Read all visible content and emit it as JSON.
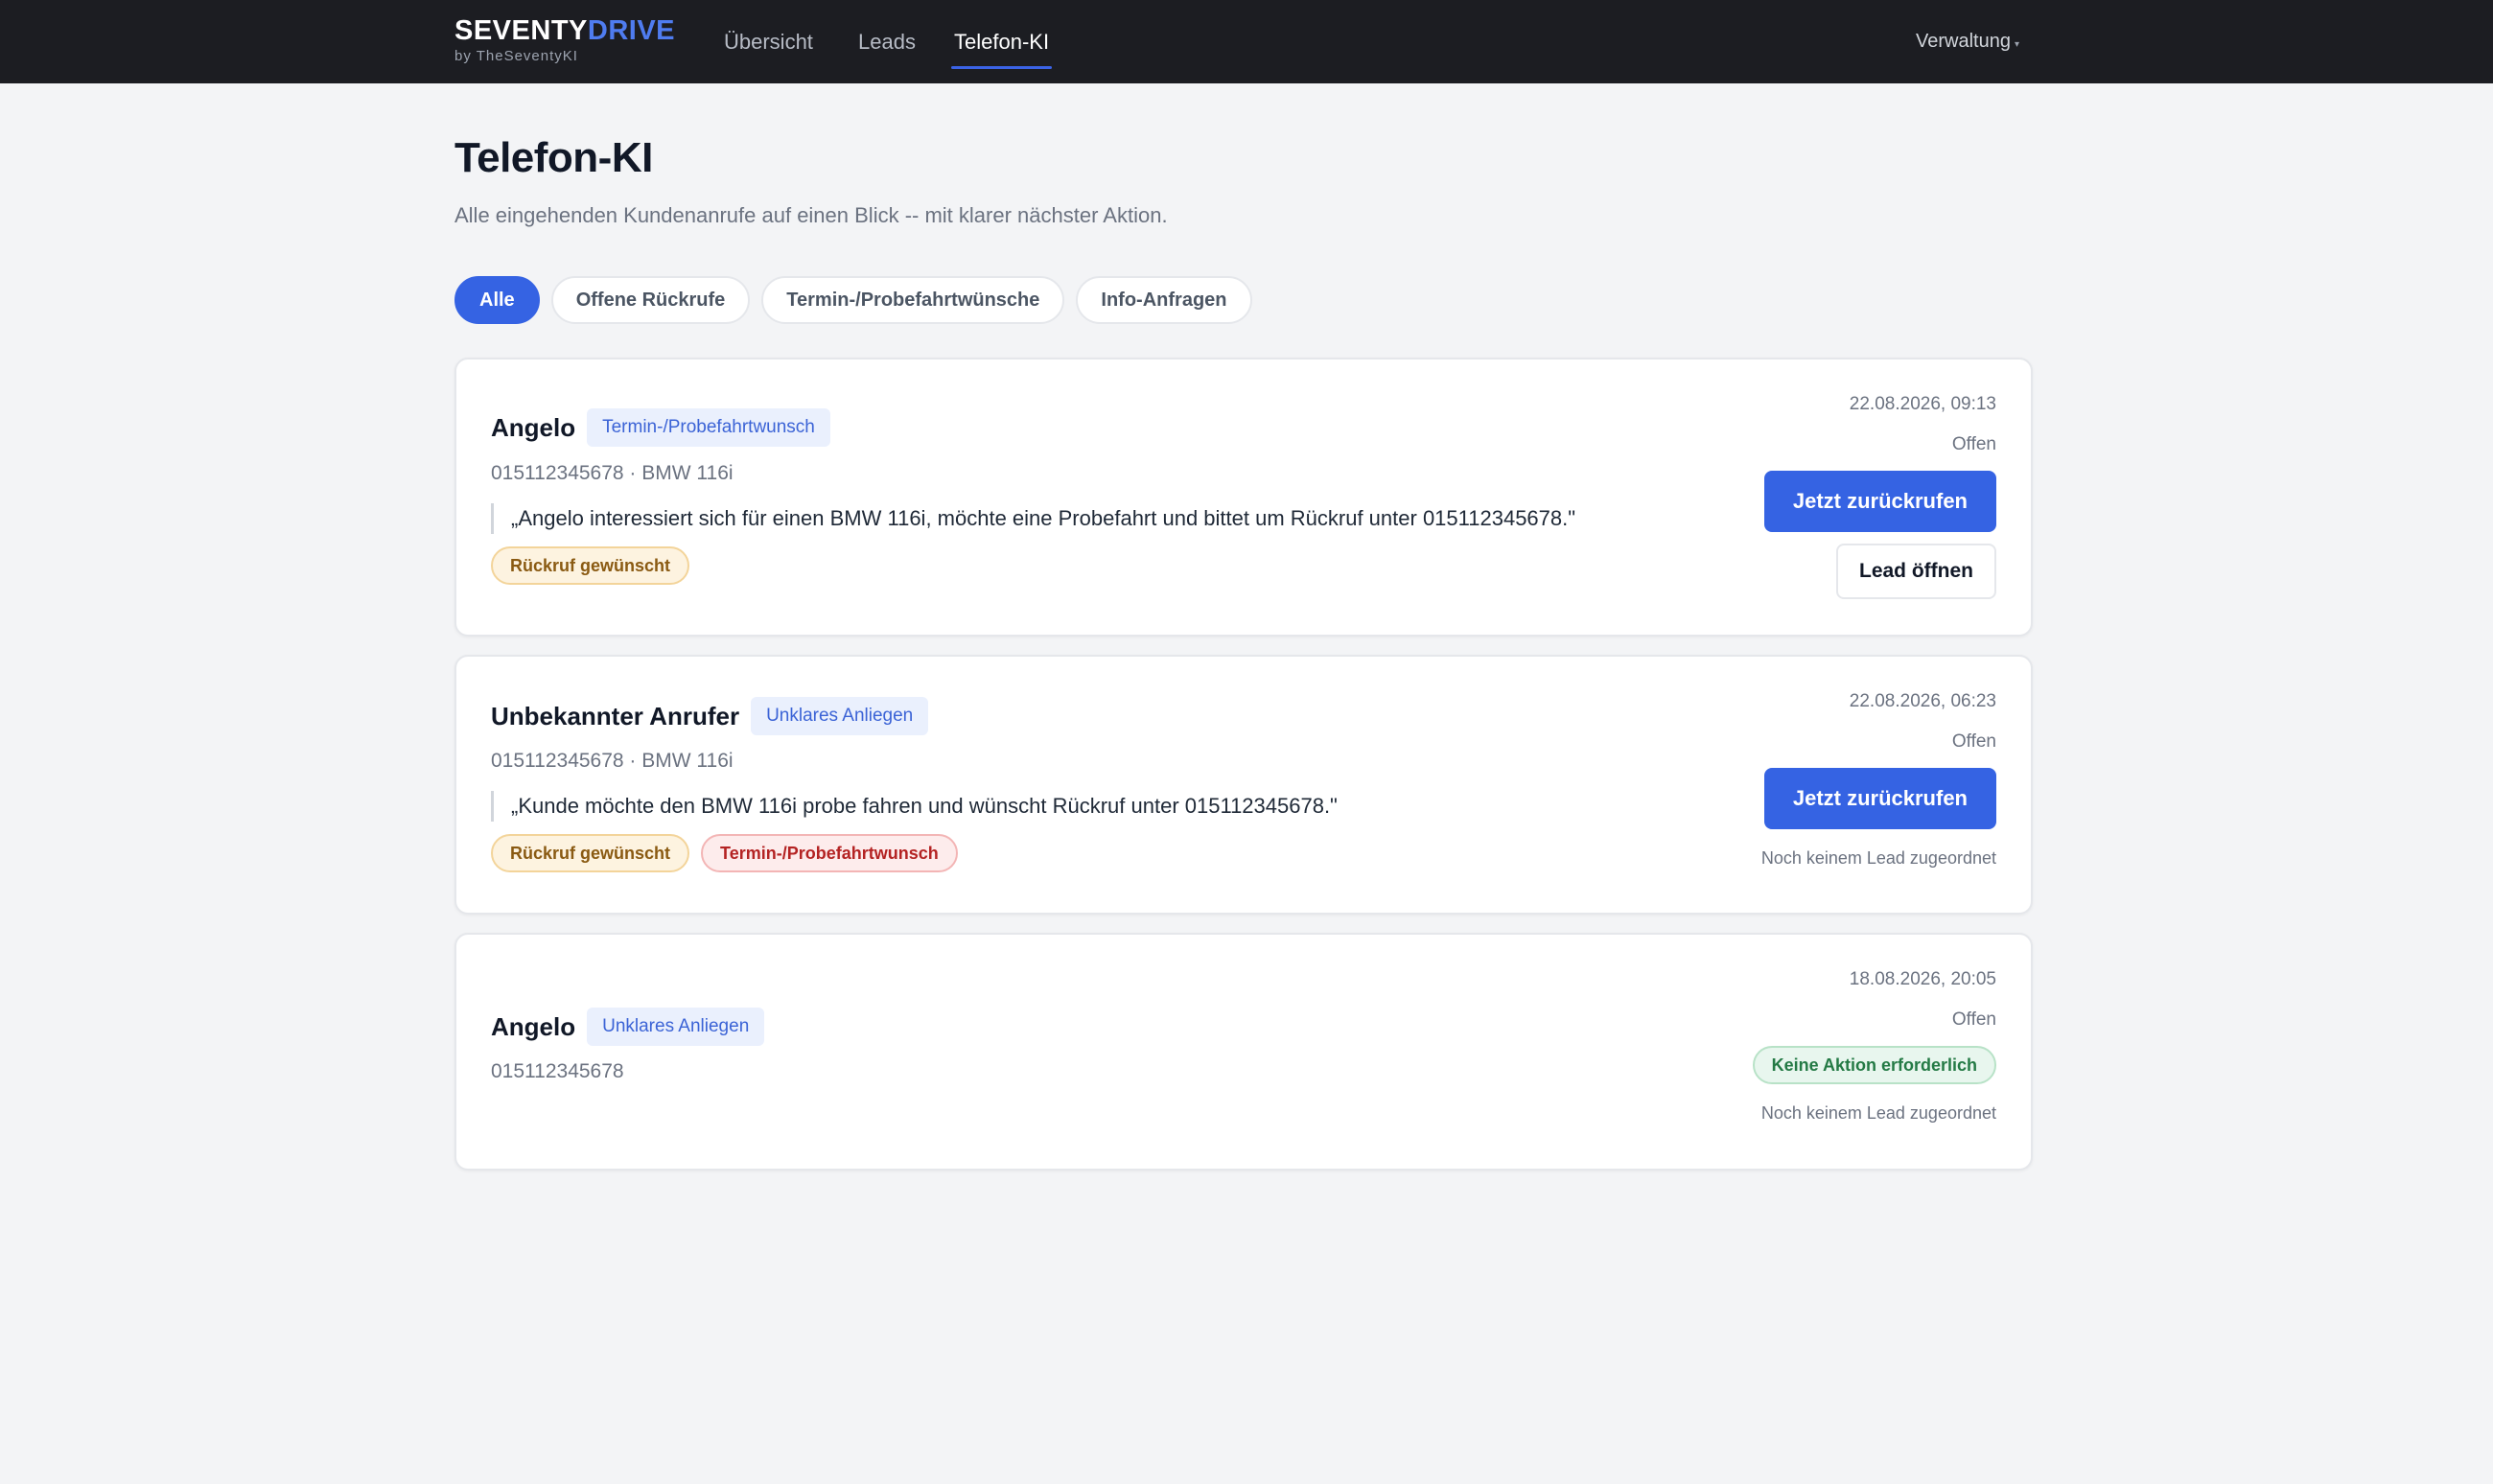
{
  "nav": {
    "brand_word1": "SEVENTY",
    "brand_word2": "DRIVE",
    "brand_sub": "by TheSeventyKI",
    "items": [
      {
        "label": "Übersicht"
      },
      {
        "label": "Leads"
      },
      {
        "label": "Telefon-KI",
        "active": true
      }
    ],
    "admin_label": "Verwaltung",
    "admin_caret": "▾"
  },
  "header": {
    "title": "Telefon-KI",
    "subtitle": "Alle eingehenden Kundenanrufe auf einen Blick -- mit klarer nächster Aktion."
  },
  "filters": [
    {
      "label": "Alle",
      "active": true
    },
    {
      "label": "Offene Rückrufe"
    },
    {
      "label": "Termin-/Probefahrtwünsche"
    },
    {
      "label": "Info-Anfragen"
    }
  ],
  "calls": [
    {
      "caller": "Angelo",
      "category": "Termin-/Probefahrtwunsch",
      "meta": "015112345678 · BMW 116i",
      "quote": "„Angelo interessiert sich für einen BMW 116i, möchte eine Probefahrt und bittet um Rückruf unter 015112345678.\"",
      "tags": [
        "Rückruf gewünscht"
      ],
      "datetime": "22.08.2026, 09:13",
      "status": "Offen",
      "primary_action": "Jetzt zurückrufen",
      "secondary_action": "Lead öffnen"
    },
    {
      "caller": "Unbekannter Anrufer",
      "category": "Unklares Anliegen",
      "meta": "015112345678 · BMW 116i",
      "quote": "„Kunde möchte den BMW 116i probe fahren und wünscht Rückruf unter 015112345678.\"",
      "tags": [
        "Rückruf gewünscht",
        "Termin-/Probefahrtwunsch"
      ],
      "datetime": "22.08.2026, 06:23",
      "status": "Offen",
      "primary_action": "Jetzt zurückrufen",
      "lead_note": "Noch keinem Lead zugeordnet"
    },
    {
      "caller": "Angelo",
      "category": "Unklares Anliegen",
      "meta": "015112345678",
      "datetime": "18.08.2026, 20:05",
      "status": "Offen",
      "action_badge": "Keine Aktion erforderlich",
      "lead_note": "Noch keinem Lead zugeordnet"
    }
  ],
  "colors": {
    "topbar": "#1c1d22",
    "accent": "#3563e3",
    "brand_accent": "#4f7cf0",
    "background": "#f3f4f6"
  }
}
